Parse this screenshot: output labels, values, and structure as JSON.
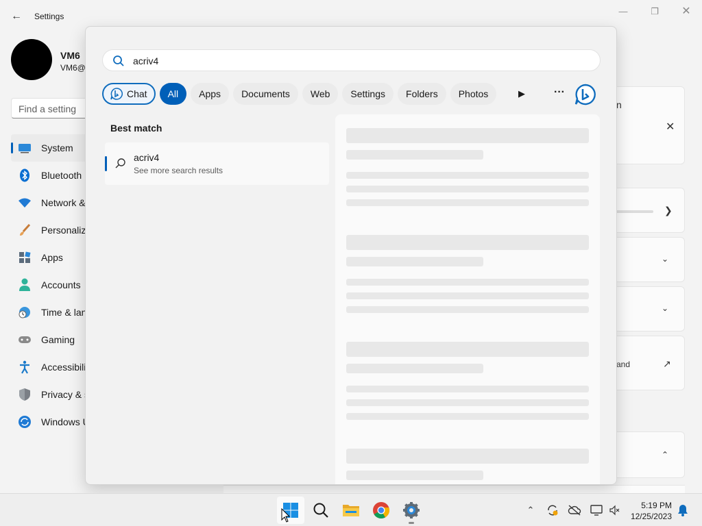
{
  "settings": {
    "title": "Settings",
    "user": {
      "name": "VM6",
      "email": "VM6@"
    },
    "find_placeholder": "Find a setting",
    "nav_items": [
      {
        "label": "System",
        "icon": "monitor-icon"
      },
      {
        "label": "Bluetooth",
        "icon": "bluetooth-icon"
      },
      {
        "label": "Network &",
        "icon": "wifi-icon"
      },
      {
        "label": "Personaliz",
        "icon": "paintbrush-icon"
      },
      {
        "label": "Apps",
        "icon": "apps-icon"
      },
      {
        "label": "Accounts",
        "icon": "person-icon"
      },
      {
        "label": "Time & lan",
        "icon": "globe-clock-icon"
      },
      {
        "label": "Gaming",
        "icon": "gamepad-icon"
      },
      {
        "label": "Accessibilit",
        "icon": "accessibility-icon"
      },
      {
        "label": "Privacy & s",
        "icon": "shield-icon"
      },
      {
        "label": "Windows U",
        "icon": "update-icon"
      }
    ],
    "right_panel": {
      "text_fragment_1": "n",
      "text_fragment_2": "and"
    }
  },
  "search": {
    "query": "acriv4",
    "filters": [
      "Chat",
      "All",
      "Apps",
      "Documents",
      "Web",
      "Settings",
      "Folders",
      "Photos"
    ],
    "active_filter": "All",
    "best_match_heading": "Best match",
    "result": {
      "title": "acriv4",
      "subtitle": "See more search results"
    }
  },
  "taskbar": {
    "apps": [
      "start-icon",
      "search-icon",
      "file-explorer-icon",
      "chrome-icon",
      "settings-gear-icon"
    ],
    "tray": [
      "chevron-up-icon",
      "sync-icon",
      "cloud-off-icon",
      "network-icon",
      "volume-mute-icon",
      "notification-bell-icon"
    ],
    "time": "5:19 PM",
    "date": "12/25/2023"
  },
  "colors": {
    "accent": "#005fb8",
    "bing_blue": "#0f6cbd",
    "flyout_bg": "#f2f2f2"
  }
}
